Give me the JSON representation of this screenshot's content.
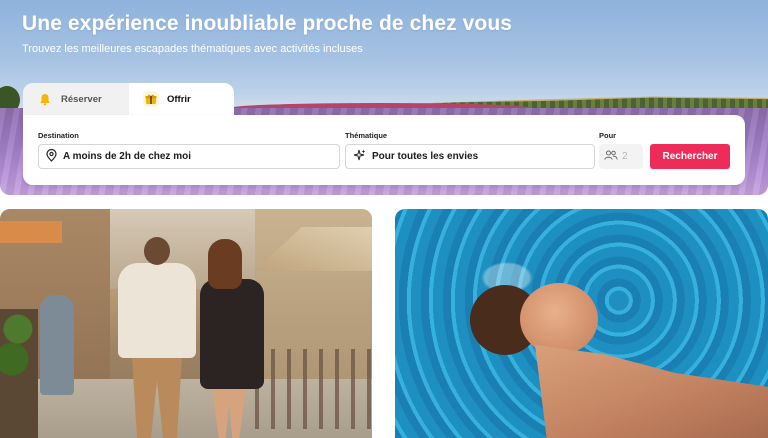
{
  "hero": {
    "title": "Une expérience inoubliable proche de chez vous",
    "subtitle": "Trouvez les meilleures escapades thématiques avec activités incluses"
  },
  "tabs": [
    {
      "label": "Réserver",
      "icon": "bell-icon",
      "active": false
    },
    {
      "label": "Offrir",
      "icon": "gift-icon",
      "active": true
    }
  ],
  "search": {
    "destination_label": "Destination",
    "destination_value": "A moins de 2h de chez moi",
    "destination_icon": "location-pin-icon",
    "theme_label": "Thématique",
    "theme_value": "Pour toutes les envies",
    "theme_icon": "sparkle-icon",
    "guests_label": "Pour",
    "guests_value": "2",
    "guests_icon": "people-icon",
    "button_label": "Rechercher"
  },
  "colors": {
    "accent": "#ee2c5a",
    "tab_inactive": "#f1f1f1",
    "text": "#1b1b1b"
  }
}
